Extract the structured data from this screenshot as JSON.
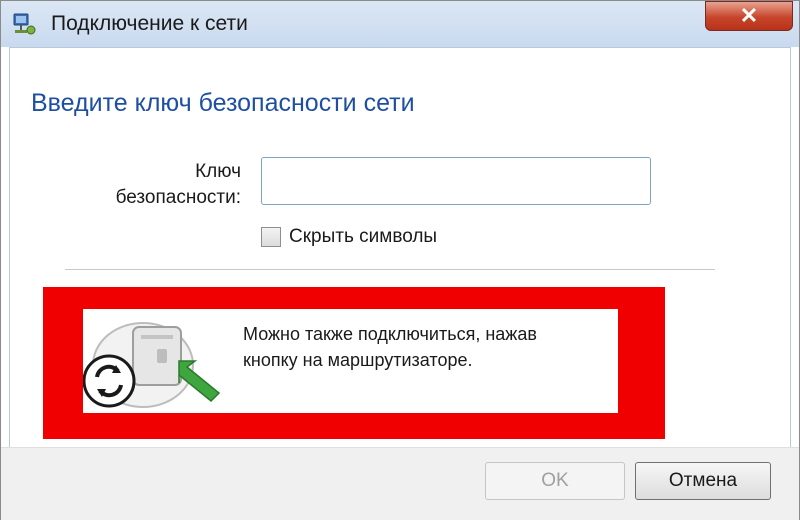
{
  "window": {
    "title": "Подключение к сети",
    "close_label": "✕"
  },
  "main": {
    "heading": "Введите ключ безопасности сети",
    "key_label_line1": "Ключ",
    "key_label_line2": "безопасности:",
    "key_value": "",
    "hide_symbols_label": "Скрыть символы",
    "hide_symbols_checked": false
  },
  "wps": {
    "line1": "Можно также подключиться, нажав",
    "line2": "кнопку на маршрутизаторе.",
    "icon": "router-wps-icon",
    "highlight_color": "#f10000"
  },
  "buttons": {
    "ok_label": "OK",
    "ok_enabled": false,
    "cancel_label": "Отмена"
  },
  "colors": {
    "heading": "#1e4fa1",
    "highlight": "#f10000"
  }
}
